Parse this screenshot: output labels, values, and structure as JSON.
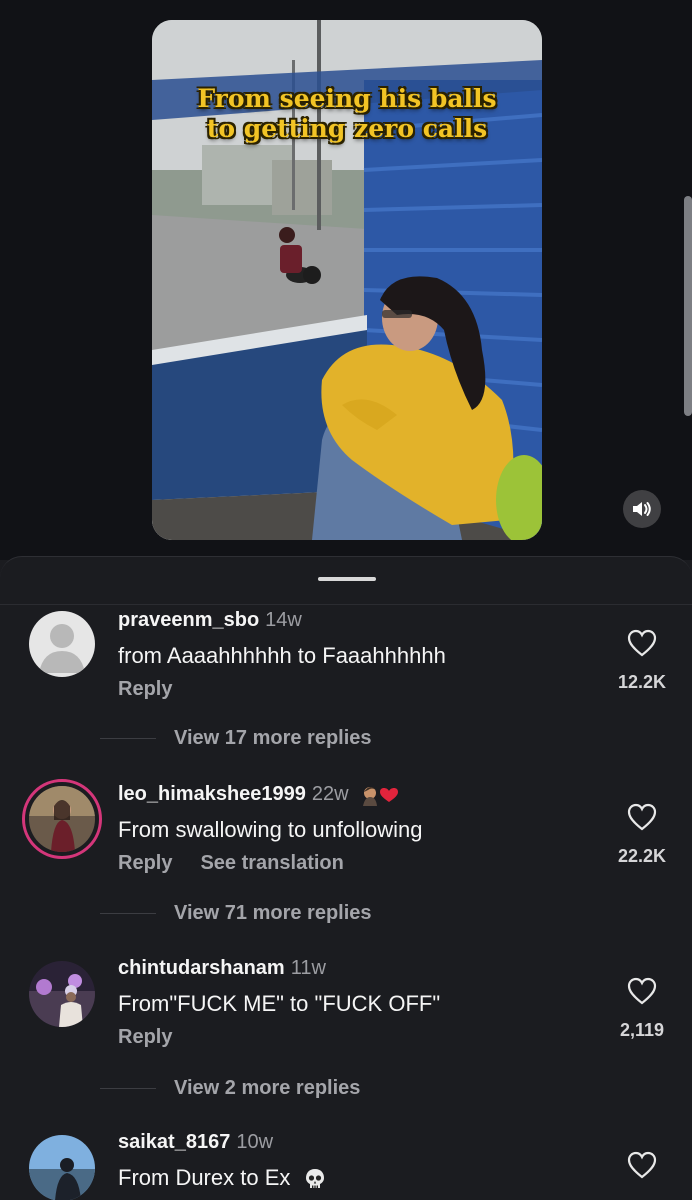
{
  "video": {
    "caption_line1": "From seeing his balls",
    "caption_line2": "to getting zero calls"
  },
  "comments": [
    {
      "username": "praveenm_sbo",
      "time": "14w",
      "text": "from Aaaahhhhhh to Faaahhhhhh",
      "reply_label": "Reply",
      "likes": "12.2K",
      "view_replies": "View 17 more replies",
      "avatar": "default-avatar"
    },
    {
      "username": "leo_himakshee1999",
      "time": "22w",
      "text": "From swallowing to unfollowing",
      "reply_label": "Reply",
      "translate_label": "See translation",
      "likes": "22.2K",
      "view_replies": "View 71 more replies",
      "avatar": "story-ring-avatar"
    },
    {
      "username": "chintudarshanam",
      "time": "11w",
      "text": "From\"FUCK ME\" to \"FUCK OFF\"",
      "reply_label": "Reply",
      "likes": "2,119",
      "view_replies": "View 2 more replies",
      "avatar": "photo-avatar"
    },
    {
      "username": "saikat_8167",
      "time": "10w",
      "text": "From Durex to Ex",
      "likes": "",
      "avatar": "photo-avatar"
    }
  ],
  "colors": {
    "background": "#1b1c20",
    "caption": "#f2c425",
    "story_ring": "#d4367a",
    "secondary_text": "#a4a5aa"
  }
}
